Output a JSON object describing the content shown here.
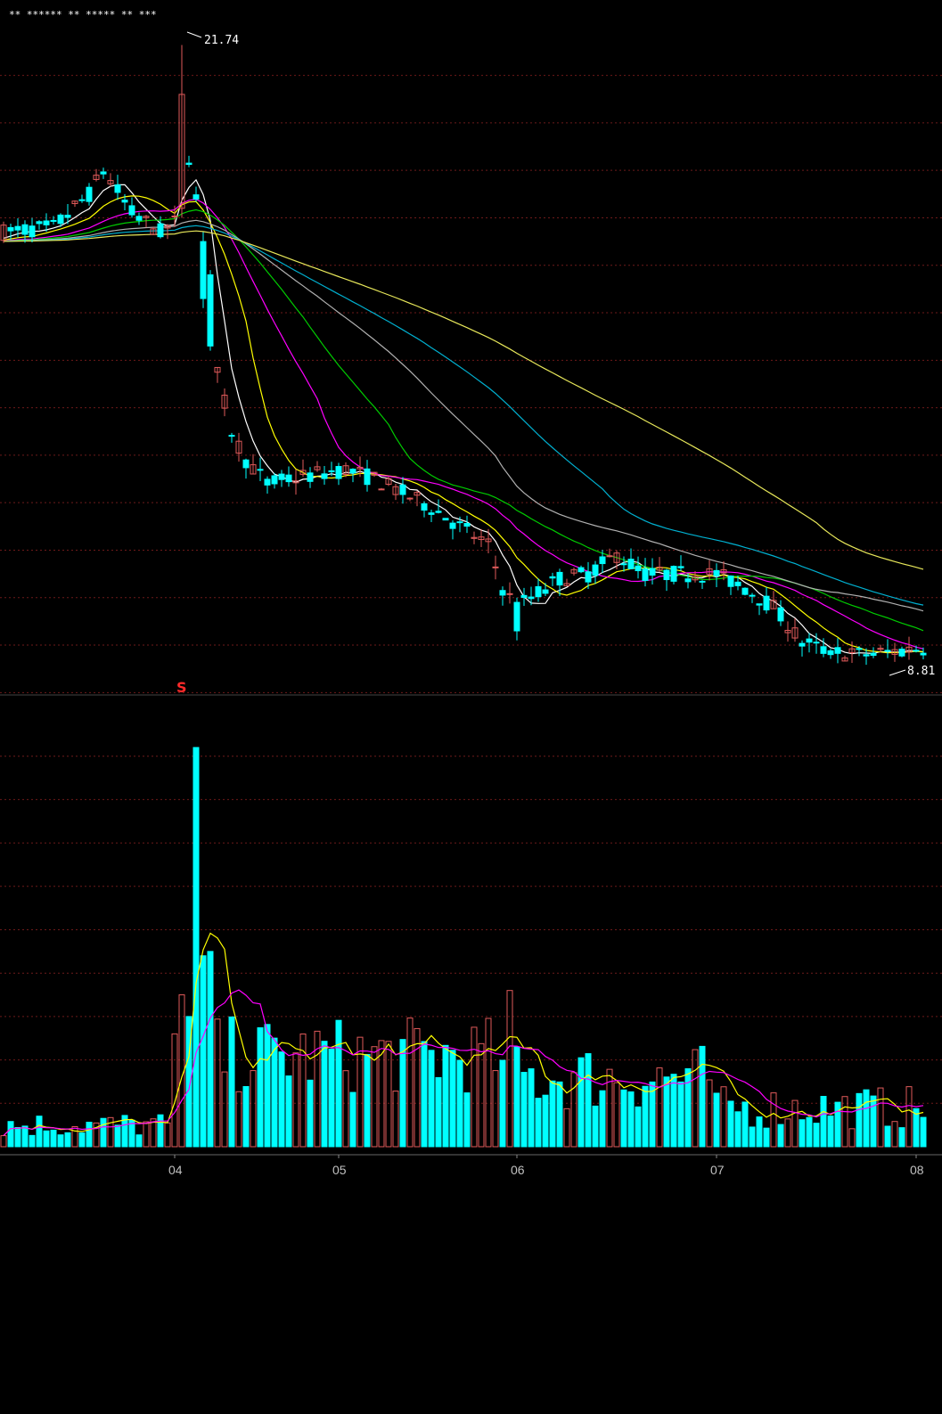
{
  "colors": {
    "background": "#000000",
    "grid": "#6e1a1a",
    "up": "#e05a5a",
    "down": "#00ffff",
    "ma": [
      "#ffffff",
      "#ffff00",
      "#ff00ff",
      "#00cc00",
      "#b0b0b0",
      "#00b0d0",
      "#e8e85a"
    ],
    "vol_ma5": "#ffff00",
    "vol_ma10": "#ff00ff"
  },
  "annotations": {
    "high_label": "21.74",
    "low_label": "8.81",
    "signal_marker": "S"
  },
  "top_marker_text": "** ****** **    ***** ** ***",
  "chart_data": [
    {
      "type": "candlestick",
      "panel": "price",
      "x_tick_labels": [
        "04",
        "05",
        "06",
        "07",
        "08"
      ],
      "ylim": [
        8.5,
        22.2
      ],
      "grid_lines_y": [
        21.1,
        20.1,
        19.1,
        18.1,
        17.1,
        16.1,
        15.1,
        14.1,
        13.1,
        12.1,
        11.1,
        10.1,
        9.1,
        8.1
      ],
      "high": 21.74,
      "low": 8.81,
      "moving_average_count": 7
    },
    {
      "type": "bar",
      "panel": "volume",
      "x_tick_labels": [
        "04",
        "05",
        "06",
        "07",
        "08"
      ],
      "ylim": [
        0,
        10
      ],
      "grid_lines_y": [
        9,
        8,
        7,
        6,
        5,
        4,
        3,
        2,
        1
      ],
      "ma_series": [
        "MA5",
        "MA10"
      ]
    }
  ]
}
